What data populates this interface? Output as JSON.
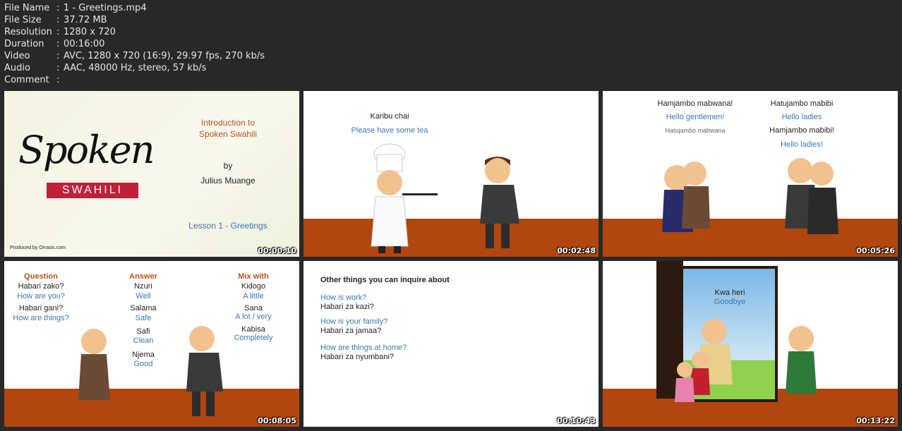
{
  "metadata": [
    {
      "key": "File Name",
      "value": "1 - Greetings.mp4"
    },
    {
      "key": "File Size",
      "value": "37.72 MB"
    },
    {
      "key": "Resolution",
      "value": "1280 x 720"
    },
    {
      "key": "Duration",
      "value": "00:16:00"
    },
    {
      "key": "Video",
      "value": "AVC, 1280 x 720 (16:9), 29.97 fps, 270 kb/s"
    },
    {
      "key": "Audio",
      "value": "AAC, 48000 Hz, stereo, 57 kb/s"
    },
    {
      "key": "Comment",
      "value": ""
    }
  ],
  "separator": ":",
  "thumbs": [
    {
      "time": "00:00:10",
      "logo_script": "Spoken",
      "logo_banner": "SWAHILI",
      "title1": "Introduction to",
      "title2": "Spoken Swahili",
      "by": "by",
      "author": "Julius Muange",
      "lesson": "Lesson 1 - Greetings",
      "credit": "Produced by Orrasis.com"
    },
    {
      "time": "00:02:48",
      "line1": "Karibu chai",
      "line2": "Please have some tea"
    },
    {
      "time": "00:05:26",
      "left1": "Hamjambo mabwana!",
      "left2": "Hello gentlemen!",
      "left3": "Hatujambo mabwana",
      "right1": "Hatujambo mabibi",
      "right2": "Hello ladies",
      "right3": "Hamjambo mabibi!",
      "right4": "Hello ladies!"
    },
    {
      "time": "00:08:05",
      "q_head": "Question",
      "q1": "Habari zako?",
      "q1t": "How are you?",
      "q2": "Habari gani?",
      "q2t": "How are things?",
      "a_head": "Answer",
      "a1": "Nzuri",
      "a1t": "Well",
      "a2": "Salama",
      "a2t": "Safe",
      "a3": "Safi",
      "a3t": "Clean",
      "a4": "Njema",
      "a4t": "Good",
      "m_head": "Mix with",
      "m1": "Kidogo",
      "m1t": "A little",
      "m2": "Sana",
      "m2t": "A lot / very",
      "m3": "Kabisa",
      "m3t": "Completely"
    },
    {
      "time": "00:10:43",
      "heading": "Other things you can inquire about",
      "i1": "How is work?",
      "i1s": "Habari za kazi?",
      "i2": "How is your family?",
      "i2s": "Habari za jamaa?",
      "i3": "How are things at home?",
      "i3s": "Habari za nyumbani?"
    },
    {
      "time": "00:13:22",
      "line1": "Kwa heri",
      "line2": "Goodbye"
    }
  ],
  "colors": {
    "floor": "#b1460f",
    "english": "#3a77b5",
    "heading": "#b5541d",
    "banner": "#c0203a"
  }
}
